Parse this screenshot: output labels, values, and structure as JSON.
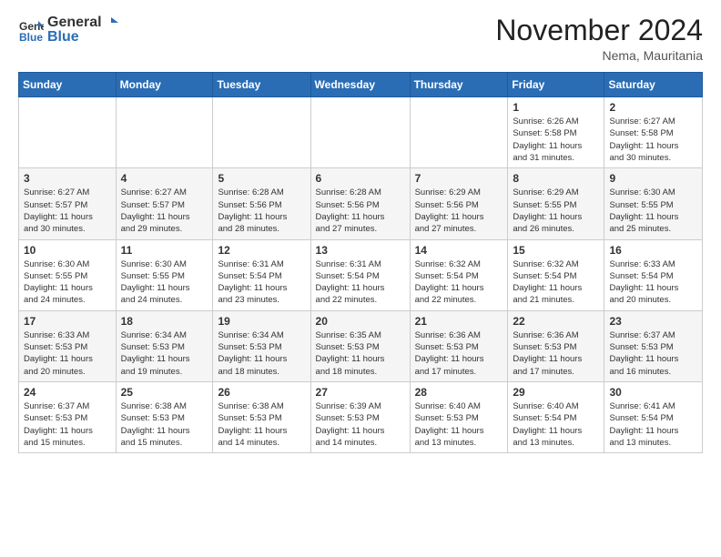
{
  "header": {
    "logo_line1": "General",
    "logo_line2": "Blue",
    "title": "November 2024",
    "location": "Nema, Mauritania"
  },
  "weekdays": [
    "Sunday",
    "Monday",
    "Tuesday",
    "Wednesday",
    "Thursday",
    "Friday",
    "Saturday"
  ],
  "rows": [
    [
      {
        "day": "",
        "info": ""
      },
      {
        "day": "",
        "info": ""
      },
      {
        "day": "",
        "info": ""
      },
      {
        "day": "",
        "info": ""
      },
      {
        "day": "",
        "info": ""
      },
      {
        "day": "1",
        "info": "Sunrise: 6:26 AM\nSunset: 5:58 PM\nDaylight: 11 hours\nand 31 minutes."
      },
      {
        "day": "2",
        "info": "Sunrise: 6:27 AM\nSunset: 5:58 PM\nDaylight: 11 hours\nand 30 minutes."
      }
    ],
    [
      {
        "day": "3",
        "info": "Sunrise: 6:27 AM\nSunset: 5:57 PM\nDaylight: 11 hours\nand 30 minutes."
      },
      {
        "day": "4",
        "info": "Sunrise: 6:27 AM\nSunset: 5:57 PM\nDaylight: 11 hours\nand 29 minutes."
      },
      {
        "day": "5",
        "info": "Sunrise: 6:28 AM\nSunset: 5:56 PM\nDaylight: 11 hours\nand 28 minutes."
      },
      {
        "day": "6",
        "info": "Sunrise: 6:28 AM\nSunset: 5:56 PM\nDaylight: 11 hours\nand 27 minutes."
      },
      {
        "day": "7",
        "info": "Sunrise: 6:29 AM\nSunset: 5:56 PM\nDaylight: 11 hours\nand 27 minutes."
      },
      {
        "day": "8",
        "info": "Sunrise: 6:29 AM\nSunset: 5:55 PM\nDaylight: 11 hours\nand 26 minutes."
      },
      {
        "day": "9",
        "info": "Sunrise: 6:30 AM\nSunset: 5:55 PM\nDaylight: 11 hours\nand 25 minutes."
      }
    ],
    [
      {
        "day": "10",
        "info": "Sunrise: 6:30 AM\nSunset: 5:55 PM\nDaylight: 11 hours\nand 24 minutes."
      },
      {
        "day": "11",
        "info": "Sunrise: 6:30 AM\nSunset: 5:55 PM\nDaylight: 11 hours\nand 24 minutes."
      },
      {
        "day": "12",
        "info": "Sunrise: 6:31 AM\nSunset: 5:54 PM\nDaylight: 11 hours\nand 23 minutes."
      },
      {
        "day": "13",
        "info": "Sunrise: 6:31 AM\nSunset: 5:54 PM\nDaylight: 11 hours\nand 22 minutes."
      },
      {
        "day": "14",
        "info": "Sunrise: 6:32 AM\nSunset: 5:54 PM\nDaylight: 11 hours\nand 22 minutes."
      },
      {
        "day": "15",
        "info": "Sunrise: 6:32 AM\nSunset: 5:54 PM\nDaylight: 11 hours\nand 21 minutes."
      },
      {
        "day": "16",
        "info": "Sunrise: 6:33 AM\nSunset: 5:54 PM\nDaylight: 11 hours\nand 20 minutes."
      }
    ],
    [
      {
        "day": "17",
        "info": "Sunrise: 6:33 AM\nSunset: 5:53 PM\nDaylight: 11 hours\nand 20 minutes."
      },
      {
        "day": "18",
        "info": "Sunrise: 6:34 AM\nSunset: 5:53 PM\nDaylight: 11 hours\nand 19 minutes."
      },
      {
        "day": "19",
        "info": "Sunrise: 6:34 AM\nSunset: 5:53 PM\nDaylight: 11 hours\nand 18 minutes."
      },
      {
        "day": "20",
        "info": "Sunrise: 6:35 AM\nSunset: 5:53 PM\nDaylight: 11 hours\nand 18 minutes."
      },
      {
        "day": "21",
        "info": "Sunrise: 6:36 AM\nSunset: 5:53 PM\nDaylight: 11 hours\nand 17 minutes."
      },
      {
        "day": "22",
        "info": "Sunrise: 6:36 AM\nSunset: 5:53 PM\nDaylight: 11 hours\nand 17 minutes."
      },
      {
        "day": "23",
        "info": "Sunrise: 6:37 AM\nSunset: 5:53 PM\nDaylight: 11 hours\nand 16 minutes."
      }
    ],
    [
      {
        "day": "24",
        "info": "Sunrise: 6:37 AM\nSunset: 5:53 PM\nDaylight: 11 hours\nand 15 minutes."
      },
      {
        "day": "25",
        "info": "Sunrise: 6:38 AM\nSunset: 5:53 PM\nDaylight: 11 hours\nand 15 minutes."
      },
      {
        "day": "26",
        "info": "Sunrise: 6:38 AM\nSunset: 5:53 PM\nDaylight: 11 hours\nand 14 minutes."
      },
      {
        "day": "27",
        "info": "Sunrise: 6:39 AM\nSunset: 5:53 PM\nDaylight: 11 hours\nand 14 minutes."
      },
      {
        "day": "28",
        "info": "Sunrise: 6:40 AM\nSunset: 5:53 PM\nDaylight: 11 hours\nand 13 minutes."
      },
      {
        "day": "29",
        "info": "Sunrise: 6:40 AM\nSunset: 5:54 PM\nDaylight: 11 hours\nand 13 minutes."
      },
      {
        "day": "30",
        "info": "Sunrise: 6:41 AM\nSunset: 5:54 PM\nDaylight: 11 hours\nand 13 minutes."
      }
    ]
  ]
}
